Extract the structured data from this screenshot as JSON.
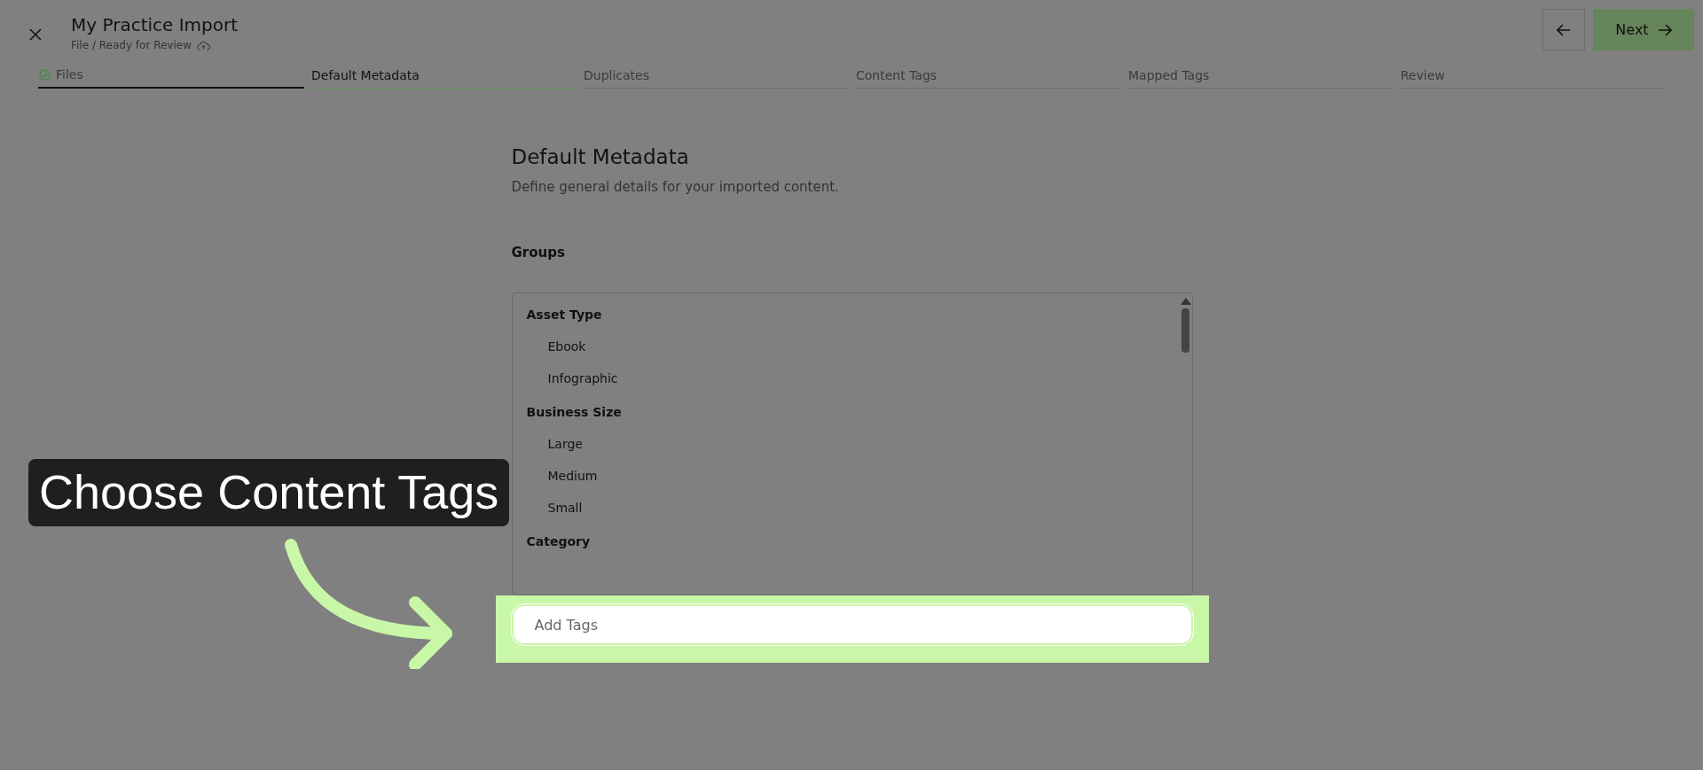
{
  "header": {
    "title": "My Practice Import",
    "subtitle": "File / Ready for Review",
    "next_label": "Next"
  },
  "steps": [
    {
      "label": "Files",
      "completed": true,
      "selected": false
    },
    {
      "label": "Default Metadata",
      "completed": false,
      "selected": true
    },
    {
      "label": "Duplicates",
      "completed": false,
      "selected": false
    },
    {
      "label": "Content Tags",
      "completed": false,
      "selected": false
    },
    {
      "label": "Mapped Tags",
      "completed": false,
      "selected": false
    },
    {
      "label": "Review",
      "completed": false,
      "selected": false
    }
  ],
  "section": {
    "title": "Default Metadata",
    "description": "Define general details for your imported content.",
    "field_label": "Groups"
  },
  "tag_groups": [
    {
      "name": "Asset Type",
      "children": [
        {
          "name": "Ebook"
        },
        {
          "name": "Infographic"
        }
      ]
    },
    {
      "name": "Business Size",
      "children": [
        {
          "name": "Large"
        },
        {
          "name": "Medium"
        },
        {
          "name": "Small"
        }
      ]
    },
    {
      "name": "Category"
    }
  ],
  "tag_input": {
    "placeholder": "Add Tags"
  },
  "callout": {
    "text": "Choose Content Tags"
  }
}
